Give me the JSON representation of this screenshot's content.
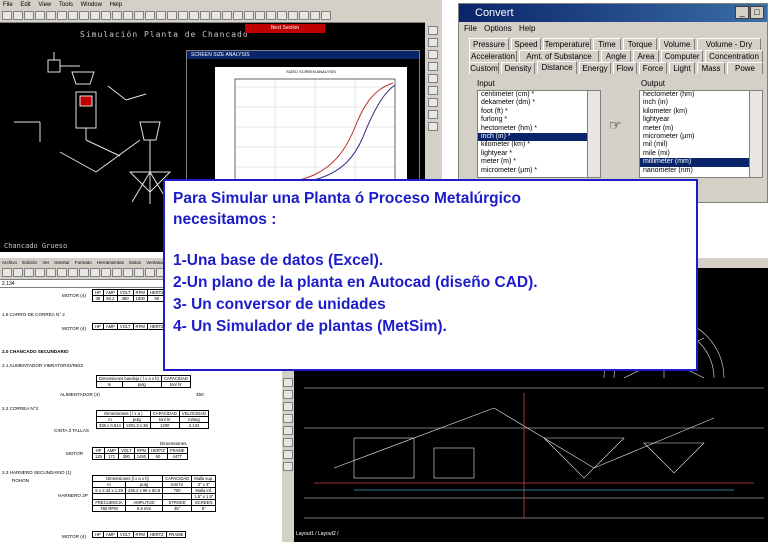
{
  "simulation_window": {
    "menu": [
      "File",
      "Edit",
      "View",
      "Tools",
      "Window",
      "Help"
    ],
    "title": "Simulación Planta de Chancado",
    "next_button": "Next Section",
    "caption": "Chancado Grueso",
    "screen_analysis": {
      "window_title": "SCREEN SIZE ANALYSIS",
      "plot_title": "SIZED SCREEN ANALYSIS"
    }
  },
  "convert_window": {
    "title": "Convert",
    "menu": [
      "File",
      "Options",
      "Help"
    ],
    "tabs_row1": [
      "Pressure",
      "Speed",
      "Temperature",
      "Time",
      "Torque",
      "Volume",
      "Volume - Dry"
    ],
    "tabs_row2": [
      "Acceleration",
      "Amt. of Substance",
      "Angle",
      "Area",
      "Computer",
      "Concentration"
    ],
    "tabs_row3": [
      "Custom",
      "Density",
      "Distance",
      "Energy",
      "Flow",
      "Force",
      "Light",
      "Mass",
      "Powe"
    ],
    "active_tab": "Distance",
    "input_label": "Input",
    "output_label": "Output",
    "input_items": [
      "centimeter (cm) *",
      "dekameter (dm) *",
      "foot (ft) *",
      "furlong *",
      "hectometer (hm) *",
      "inch (in) *",
      "kilometer (km) *",
      "lightyear *",
      "meter (m) *",
      "micrometer (µm) *"
    ],
    "input_selected": 5,
    "output_items": [
      "hectometer (hm)",
      "inch (in)",
      "kilometer (km)",
      "lightyear",
      "meter (m)",
      "micrometer (µm)",
      "mil (mil)",
      "mile (mi)",
      "millimeter (mm)",
      "nanometer (nm)"
    ],
    "output_selected": 8,
    "hand_icon": "pointing-hand-icon"
  },
  "excel_window": {
    "menu": [
      "Archivo",
      "Edición",
      "Ver",
      "Insertar",
      "Formato",
      "Herramientas",
      "Datos",
      "Ventana",
      "?"
    ],
    "formula_value": "2.134",
    "rows": {
      "motor1": {
        "label": "MOTOR (4)",
        "headers": [
          "HP",
          "AMP",
          "VOLT",
          "RPM",
          "HERTZ",
          "FRAME"
        ],
        "values": [
          "40",
          "60.2",
          "380",
          "1800",
          "60",
          "324T"
        ]
      },
      "sec_1_6": "1.6    CARRO DE CORREA N° 2",
      "motor2": {
        "label": "MOTOR (4)",
        "headers": [
          "HP",
          "AMP",
          "VOLT",
          "RPM",
          "HERTZ",
          "FRAME"
        ]
      },
      "sec_2_0": "2.0   CHANCADO SECUNDARIO",
      "sec_2_1": "2.1    ALIMENTADOR VIBRATORIO/REIZ",
      "feeder": {
        "header": "Dimensiones bandeja ( l x a x h)",
        "cap_header": "CAPACIDAD",
        "units": [
          "m",
          "pulg",
          "ton/ hr"
        ],
        "label": "ALIMENTADOR (4)",
        "capacity": "450"
      },
      "sec_2_2": "2.2    CORREA N°3",
      "belt": {
        "header": "Dimensiones ( l x a )",
        "cap": "CAPACIDAD",
        "vel": "VELOCIDAD",
        "units": [
          "m",
          "pulg",
          "ton/ hr",
          "m/seg"
        ],
        "label": "CINTA 3 TALLAS",
        "values": [
          "335 x 0.914",
          "1291.3 x 36",
          "1200",
          "2.134"
        ]
      },
      "motor3": {
        "dim_header": "Dimensiones",
        "label": "MOTOR",
        "headers": [
          "HP",
          "AMP",
          "VOLT",
          "RPM",
          "HERTZ",
          "FRAME"
        ],
        "values": [
          "125",
          "171",
          "380",
          "1490",
          "60",
          "447T"
        ]
      },
      "sec_2_3": "2.3    HARNERO SECUNDARIO (1)",
      "sec_2_3b": "ROHON",
      "screen": {
        "header": "Dimensiones (l x a x h)",
        "cap": "CAPACIDAD",
        "malla": "Malla sup.",
        "units": [
          "m",
          "pulg",
          "ton/ hr",
          "3\" x 3\""
        ],
        "label": "HARNERO 2P",
        "values": [
          "S x 2.42 x 1.29",
          "236.2 x 96 x 50.8",
          "700",
          "Malla inf."
        ],
        "malla_inf": "1.5\" x 1.5\"",
        "freq_headers": [
          "FRECUENCIA",
          "AMPLITUD",
          "STROKE",
          "SCREEN"
        ],
        "freq_values": [
          "760 RPM",
          "6.5 mm",
          "45°",
          "5°"
        ]
      },
      "motor4": {
        "label": "MOTOR (4)",
        "headers": [
          "HP",
          "AMP",
          "VOLT",
          "RPM",
          "HERTZ",
          "FRAME"
        ]
      }
    }
  },
  "cad_window": {
    "tabs": "Layout1 / Layout2 /"
  },
  "overlay": {
    "line1": "Para Simular una Planta ó Proceso Metalúrgico",
    "line2": "necesitamos :",
    "line3": "1-Una base de datos (Excel).",
    "line4": "2-Un plano de la planta en Autocad (diseño CAD).",
    "line5": "3- Un conversor de unidades",
    "line6": "4- Un  Simulador de plantas (MetSim)."
  },
  "colors": {
    "overlay_text": "#1c1cc8",
    "title_bar": "#0a246a",
    "window_face": "#d4d0c8"
  }
}
